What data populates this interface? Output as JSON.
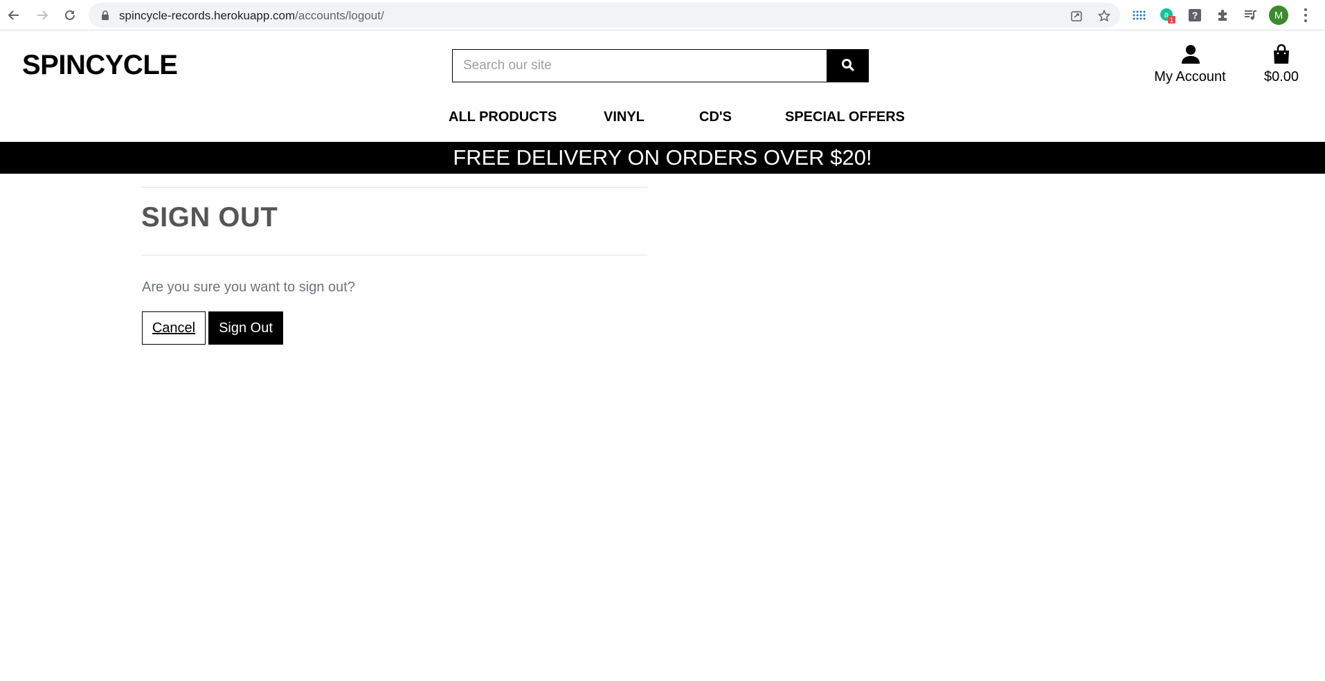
{
  "browser": {
    "url_host": "spincycle-records.herokuapp.com",
    "url_path": "/accounts/logout/",
    "profile_initial": "M",
    "extension_badge": "1"
  },
  "header": {
    "logo": "SPINCYCLE",
    "search_placeholder": "Search our site",
    "account_label": "My Account",
    "bag_total": "$0.00"
  },
  "nav": {
    "items": [
      "ALL PRODUCTS",
      "VINYL",
      "CD'S",
      "SPECIAL OFFERS"
    ]
  },
  "promo": {
    "text": "FREE DELIVERY ON ORDERS OVER $20!"
  },
  "signout": {
    "title": "SIGN OUT",
    "question": "Are you sure you want to sign out?",
    "cancel_label": "Cancel",
    "signout_label": "Sign Out"
  }
}
